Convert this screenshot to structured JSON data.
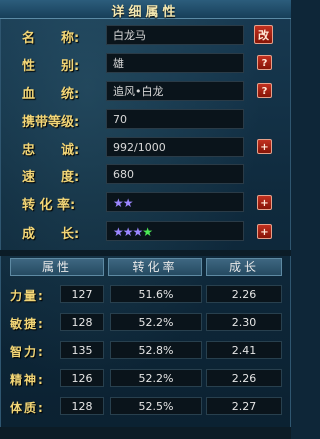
{
  "title": "详细属性",
  "info": [
    {
      "label": "名　　称:",
      "value": "白龙马",
      "button": "改"
    },
    {
      "label": "性　　别:",
      "value": "雄",
      "button": "?"
    },
    {
      "label": "血　　统:",
      "value": "追风•白龙",
      "button": "?"
    },
    {
      "label": "携带等级:",
      "value": "70"
    },
    {
      "label": "忠　　诚:",
      "value": "992/1000",
      "button": "+"
    },
    {
      "label": "速　　度:",
      "value": "680"
    },
    {
      "label": "转 化 率:",
      "stars": {
        "purple": 2,
        "green": 0
      },
      "button": "+"
    },
    {
      "label": "成　　长:",
      "stars": {
        "purple": 3,
        "green": 1
      },
      "button": "+"
    }
  ],
  "table": {
    "headers": [
      "属性",
      "转化率",
      "成长"
    ],
    "rows": [
      {
        "name": "力量:",
        "value": "127",
        "rate": "51.6%",
        "growth": "2.26"
      },
      {
        "name": "敏捷:",
        "value": "128",
        "rate": "52.2%",
        "growth": "2.30"
      },
      {
        "name": "智力:",
        "value": "135",
        "rate": "52.8%",
        "growth": "2.41"
      },
      {
        "name": "精神:",
        "value": "126",
        "rate": "52.2%",
        "growth": "2.26"
      },
      {
        "name": "体质:",
        "value": "128",
        "rate": "52.5%",
        "growth": "2.27"
      }
    ]
  },
  "icons": {
    "star": "star-icon"
  }
}
